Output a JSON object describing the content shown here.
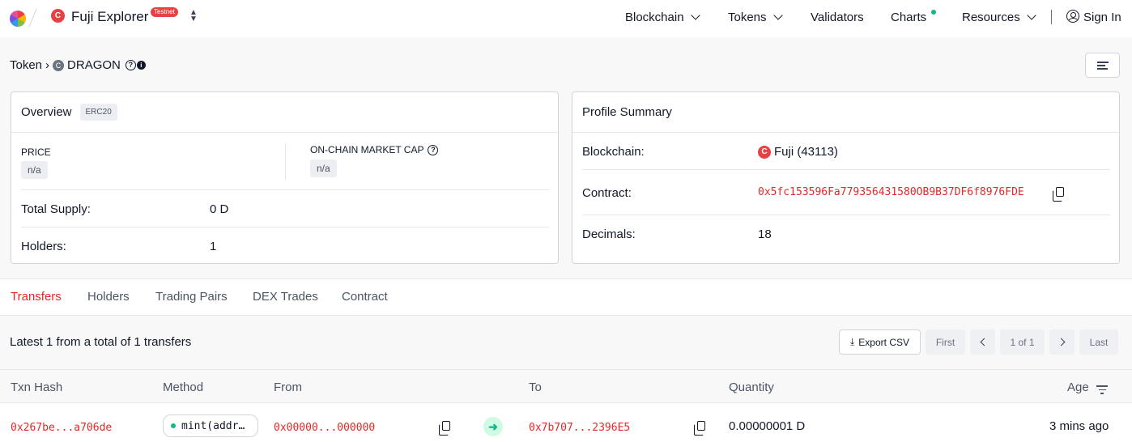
{
  "header": {
    "brand": "Fuji Explorer",
    "badge": "Testnet",
    "chain_logo_letter": "C",
    "nav": [
      {
        "label": "Blockchain"
      },
      {
        "label": "Tokens"
      },
      {
        "label": "Validators"
      },
      {
        "label": "Charts"
      },
      {
        "label": "Resources"
      }
    ],
    "sign_in": "Sign In"
  },
  "breadcrumb": {
    "parent": "Token",
    "separator": "›",
    "token_logo_letter": "C",
    "token": "DRAGON"
  },
  "overview": {
    "title": "Overview",
    "standard": "ERC20",
    "price_label": "PRICE",
    "price_value": "n/a",
    "mcap_label": "ON-CHAIN MARKET CAP",
    "mcap_value": "n/a",
    "total_supply_label": "Total Supply:",
    "total_supply_value": "0 D",
    "holders_label": "Holders:",
    "holders_value": "1"
  },
  "profile": {
    "title": "Profile Summary",
    "blockchain_label": "Blockchain:",
    "blockchain_logo_letter": "C",
    "blockchain_value": "Fuji (43113)",
    "contract_label": "Contract:",
    "contract_value": "0x5fc153596Fa779356431580OB9B37DF6f8976FDE",
    "decimals_label": "Decimals:",
    "decimals_value": "18"
  },
  "tabs": [
    "Transfers",
    "Holders",
    "Trading Pairs",
    "DEX Trades",
    "Contract"
  ],
  "active_tab": "Transfers",
  "transfers": {
    "summary": "Latest 1 from a total of 1 transfers",
    "export": "Export CSV",
    "first": "First",
    "page": "1 of 1",
    "last": "Last",
    "columns": [
      "Txn Hash",
      "Method",
      "From",
      "To",
      "Quantity",
      "Age"
    ],
    "rows": [
      {
        "hash": "0x267be...a706de",
        "method": "mint(addr…",
        "from": "0x00000...000000",
        "to": "0x7b707...2396E5",
        "quantity": "0.00000001 D",
        "age": "3 mins ago"
      }
    ]
  },
  "colors": {
    "accent": "#e22828",
    "avalanche_red": "#e84142",
    "success": "#10b981"
  },
  "icons": [
    "chevron-down-icon",
    "user-icon",
    "question-icon",
    "info-icon",
    "filter-icon",
    "copy-icon",
    "download-icon",
    "arrow-right-icon",
    "sort-icon"
  ]
}
